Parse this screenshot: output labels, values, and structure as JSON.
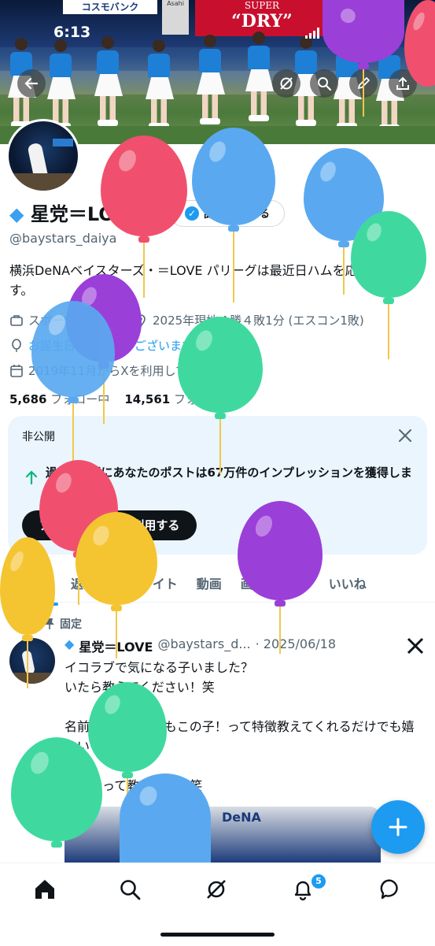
{
  "status_bar": {
    "time": "6:13",
    "battery": "100"
  },
  "banner": {
    "signs": [
      "コスモバンク",
      "SUPER",
      "“DRY”",
      "Asahi"
    ]
  },
  "profile": {
    "name": "星党＝LOVE",
    "handle": "@baystars_daiya",
    "verify_button": "認証を受ける",
    "bio": "横浜DeNAベイスターズ・＝LOVE パリーグは最近日ハムを応援しています。",
    "category": "スポーツリーグ",
    "location": "2025年現地４勝４敗1分 (エスコン1敗)",
    "birthday": "お誕生日おめでとうございます。",
    "joined": "2019年11月からXを利用しています",
    "following_count": "5,686",
    "following_label": "フォロー中",
    "followers_count": "14,561",
    "followers_label": "フォロワー"
  },
  "private_card": {
    "label": "非公開",
    "message": "過去7日間にあなたのポストは67万件のインプレッションを獲得しました",
    "button": "アナリティクスを利用する"
  },
  "tabs": [
    "ポスト",
    "返信",
    "ハイライト",
    "動画",
    "画像",
    "記事",
    "いいね"
  ],
  "pinned_post": {
    "pinned_label": "固定",
    "name": "星党＝LOVE",
    "handle": "@baystars_d...",
    "date": "· 2025/06/18",
    "text": "イコラブで気になる子いました？\nいたら教えてください！笑\n\n名前分からなくてもこの子！って特徴教えてくれるだけでも嬉しいです^_^\n\n責任持って教えます！笑",
    "image_text": "DeNA"
  },
  "bottom_nav": {
    "items": [
      "home-icon",
      "search-icon",
      "grok-icon",
      "notifications-icon",
      "messages-icon"
    ],
    "notification_badge": "5"
  },
  "colors": {
    "accent": "#1d9bf0",
    "balloon_red": "#f0506e",
    "balloon_blue": "#5aa9f0",
    "balloon_green": "#3fd9a0",
    "balloon_purple": "#9b3fd9",
    "balloon_yellow": "#f5c431"
  }
}
